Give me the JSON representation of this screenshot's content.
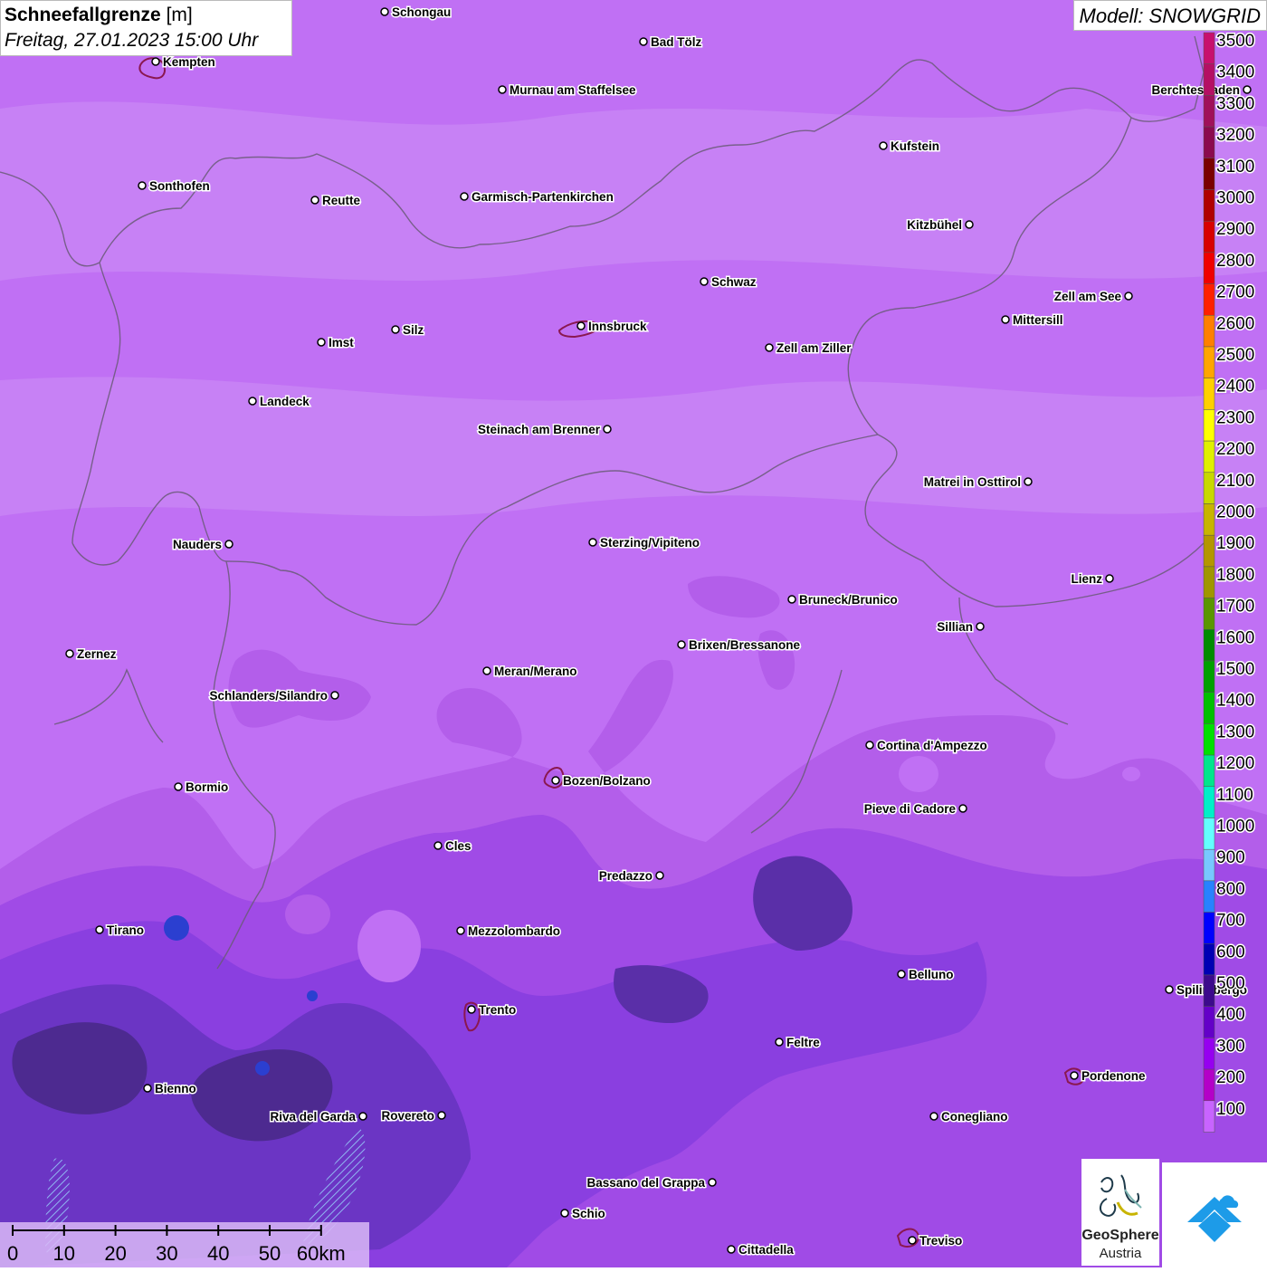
{
  "title": {
    "main": "Schneefallgrenze",
    "unit": "[m]",
    "datetime": "Freitag, 27.01.2023 15:00 Uhr"
  },
  "model_label": "Modell: SNOWGRID",
  "legend": [
    {
      "value": "3500",
      "color": "#c8106e"
    },
    {
      "value": "3400",
      "color": "#b50f64"
    },
    {
      "value": "3300",
      "color": "#a0105a"
    },
    {
      "value": "3200",
      "color": "#8b0a4e"
    },
    {
      "value": "3100",
      "color": "#7a0000"
    },
    {
      "value": "3000",
      "color": "#b00000"
    },
    {
      "value": "2900",
      "color": "#d80000"
    },
    {
      "value": "2800",
      "color": "#f00000"
    },
    {
      "value": "2700",
      "color": "#ff2000"
    },
    {
      "value": "2600",
      "color": "#ff7f00"
    },
    {
      "value": "2500",
      "color": "#ffa500"
    },
    {
      "value": "2400",
      "color": "#ffd000"
    },
    {
      "value": "2300",
      "color": "#ffff00"
    },
    {
      "value": "2200",
      "color": "#e0f000"
    },
    {
      "value": "2100",
      "color": "#c8d800"
    },
    {
      "value": "2000",
      "color": "#c8b400"
    },
    {
      "value": "1900",
      "color": "#b49600"
    },
    {
      "value": "1800",
      "color": "#a09600"
    },
    {
      "value": "1700",
      "color": "#5a9600"
    },
    {
      "value": "1600",
      "color": "#008c00"
    },
    {
      "value": "1500",
      "color": "#00a000"
    },
    {
      "value": "1400",
      "color": "#00c000"
    },
    {
      "value": "1300",
      "color": "#00e000"
    },
    {
      "value": "1200",
      "color": "#00e68c"
    },
    {
      "value": "1100",
      "color": "#00f0c8"
    },
    {
      "value": "1000",
      "color": "#64ffff"
    },
    {
      "value": "900",
      "color": "#78c8ff"
    },
    {
      "value": "800",
      "color": "#2882ff"
    },
    {
      "value": "700",
      "color": "#0000ff"
    },
    {
      "value": "600",
      "color": "#0000b4"
    },
    {
      "value": "500",
      "color": "#3c0a8c"
    },
    {
      "value": "400",
      "color": "#6400c8"
    },
    {
      "value": "300",
      "color": "#9600f0"
    },
    {
      "value": "200",
      "color": "#b400c8"
    },
    {
      "value": "100",
      "color": "#c864ff"
    }
  ],
  "cities": [
    {
      "name": "Schongau",
      "side": "right"
    },
    {
      "name": "Bad Tölz",
      "side": "right"
    },
    {
      "name": "Kempten",
      "side": "right"
    },
    {
      "name": "Murnau am Staffelsee",
      "side": "right"
    },
    {
      "name": "Kufstein",
      "side": "right"
    },
    {
      "name": "Berchtesgaden",
      "side": "left"
    },
    {
      "name": "Sonthofen",
      "side": "right"
    },
    {
      "name": "Reutte",
      "side": "right"
    },
    {
      "name": "Garmisch-Partenkirchen",
      "side": "right"
    },
    {
      "name": "Kitzbühel",
      "side": "left"
    },
    {
      "name": "Schwaz",
      "side": "right"
    },
    {
      "name": "Zell am See",
      "side": "left"
    },
    {
      "name": "Mittersill",
      "side": "right"
    },
    {
      "name": "Innsbruck",
      "side": "right"
    },
    {
      "name": "Imst",
      "side": "right"
    },
    {
      "name": "Silz",
      "side": "right"
    },
    {
      "name": "Zell am Ziller",
      "side": "right"
    },
    {
      "name": "Landeck",
      "side": "right"
    },
    {
      "name": "Steinach am Brenner",
      "side": "left"
    },
    {
      "name": "Matrei in Osttirol",
      "side": "left"
    },
    {
      "name": "Nauders",
      "side": "left"
    },
    {
      "name": "Sterzing/Vipiteno",
      "side": "right"
    },
    {
      "name": "Lienz",
      "side": "left"
    },
    {
      "name": "Bruneck/Brunico",
      "side": "right"
    },
    {
      "name": "Sillian",
      "side": "left"
    },
    {
      "name": "Brixen/Bressanone",
      "side": "right"
    },
    {
      "name": "Zernez",
      "side": "right"
    },
    {
      "name": "Meran/Merano",
      "side": "right"
    },
    {
      "name": "Schlanders/Silandro",
      "side": "left"
    },
    {
      "name": "Cortina d'Ampezzo",
      "side": "right"
    },
    {
      "name": "Bozen/Bolzano",
      "side": "right"
    },
    {
      "name": "Bormio",
      "side": "right"
    },
    {
      "name": "Pieve di Cadore",
      "side": "left"
    },
    {
      "name": "Cles",
      "side": "right"
    },
    {
      "name": "Predazzo",
      "side": "left"
    },
    {
      "name": "Tirano",
      "side": "right"
    },
    {
      "name": "Mezzolombardo",
      "side": "right"
    },
    {
      "name": "Belluno",
      "side": "right"
    },
    {
      "name": "Spilimbergo",
      "side": "right"
    },
    {
      "name": "Trento",
      "side": "right"
    },
    {
      "name": "Feltre",
      "side": "right"
    },
    {
      "name": "Pordenone",
      "side": "right"
    },
    {
      "name": "Bienno",
      "side": "right"
    },
    {
      "name": "Riva del Garda",
      "side": "left"
    },
    {
      "name": "Rovereto",
      "side": "left"
    },
    {
      "name": "Conegliano",
      "side": "right"
    },
    {
      "name": "Bassano del Grappa",
      "side": "left"
    },
    {
      "name": "Schio",
      "side": "right"
    },
    {
      "name": "Treviso",
      "side": "right"
    },
    {
      "name": "Cittadella",
      "side": "right"
    }
  ],
  "scale_bar": {
    "ticks": [
      "0",
      "10",
      "20",
      "30",
      "40",
      "50",
      "60km"
    ]
  },
  "logos": {
    "geosphere_line1": "GeoSphere",
    "geosphere_line2": "Austria"
  },
  "colors": {
    "base": "#c070f4",
    "mid": "#a455e8",
    "deep": "#8a3fe0",
    "dark": "#5a2fa8",
    "magenta": "#b34ee0",
    "border": "#6a5a78",
    "blue_accent": "#1d9be8"
  }
}
